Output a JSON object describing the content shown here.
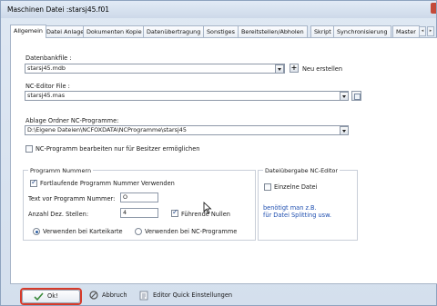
{
  "window": {
    "title": "Maschinen Datei :starsj45.f01"
  },
  "tabs": [
    {
      "label": "Allgemein",
      "active": true
    },
    {
      "label": "Datei Anlage",
      "active": false
    },
    {
      "label": "Dokumenten Kopie",
      "active": false
    },
    {
      "label": "Datenübertragung",
      "active": false
    },
    {
      "label": "Sonstiges",
      "active": false
    },
    {
      "label": "Bereitstellen/Abholen",
      "active": false
    },
    {
      "label": "Skript",
      "active": false
    },
    {
      "label": "Synchronisierung",
      "active": false
    },
    {
      "label": "Master",
      "active": false
    }
  ],
  "tab_scroll": {
    "left": "◂",
    "right": "▸"
  },
  "database": {
    "label": "Datenbankfile :",
    "value": "starsj45.mdb",
    "new_label": "Neu erstellen",
    "plus": "+"
  },
  "nc_editor": {
    "label": "NC-Editor File :",
    "value": "starsj45.mas"
  },
  "nc_folder": {
    "label": "Ablage Ordner NC-Programme:",
    "value": "D:\\Eigene Dateien\\NCFOXDATA\\NCProgramme\\starsj45"
  },
  "owner_only": {
    "label": "NC-Programm bearbeiten nur für Besitzer ermöglichen",
    "checked": false
  },
  "program_numbers": {
    "title": "Programm Nummern",
    "continuous_label": "Fortlaufende Programm Nummer Verwenden",
    "continuous_checked": true,
    "prefix_label": "Text vor Programm Nummer:",
    "prefix_value": "O",
    "decimals_label": "Anzahl Dez. Stellen:",
    "decimals_value": "4",
    "leading_zero_label": "Führende Nullen",
    "leading_zero_checked": true,
    "radio_karteikarte": "Verwenden bei Karteikarte",
    "radio_nc": "Verwenden bei NC-Programme",
    "selected": "karteikarte"
  },
  "file_transfer": {
    "title": "Dateiübergabe NC-Editor",
    "single_file_label": "Einzelne Datei",
    "single_file_checked": false,
    "note_line1": "benötigt man z.B.",
    "note_line2": "für Datei Splitting usw."
  },
  "footer": {
    "ok_label": "Ok!",
    "abort_label": "Abbruch",
    "settings_label": "Editor Quick Einstellungen"
  },
  "colors": {
    "accent_blue": "#2c4f8c",
    "note_blue": "#1f4fb0",
    "highlight_red": "#d63a2a"
  }
}
